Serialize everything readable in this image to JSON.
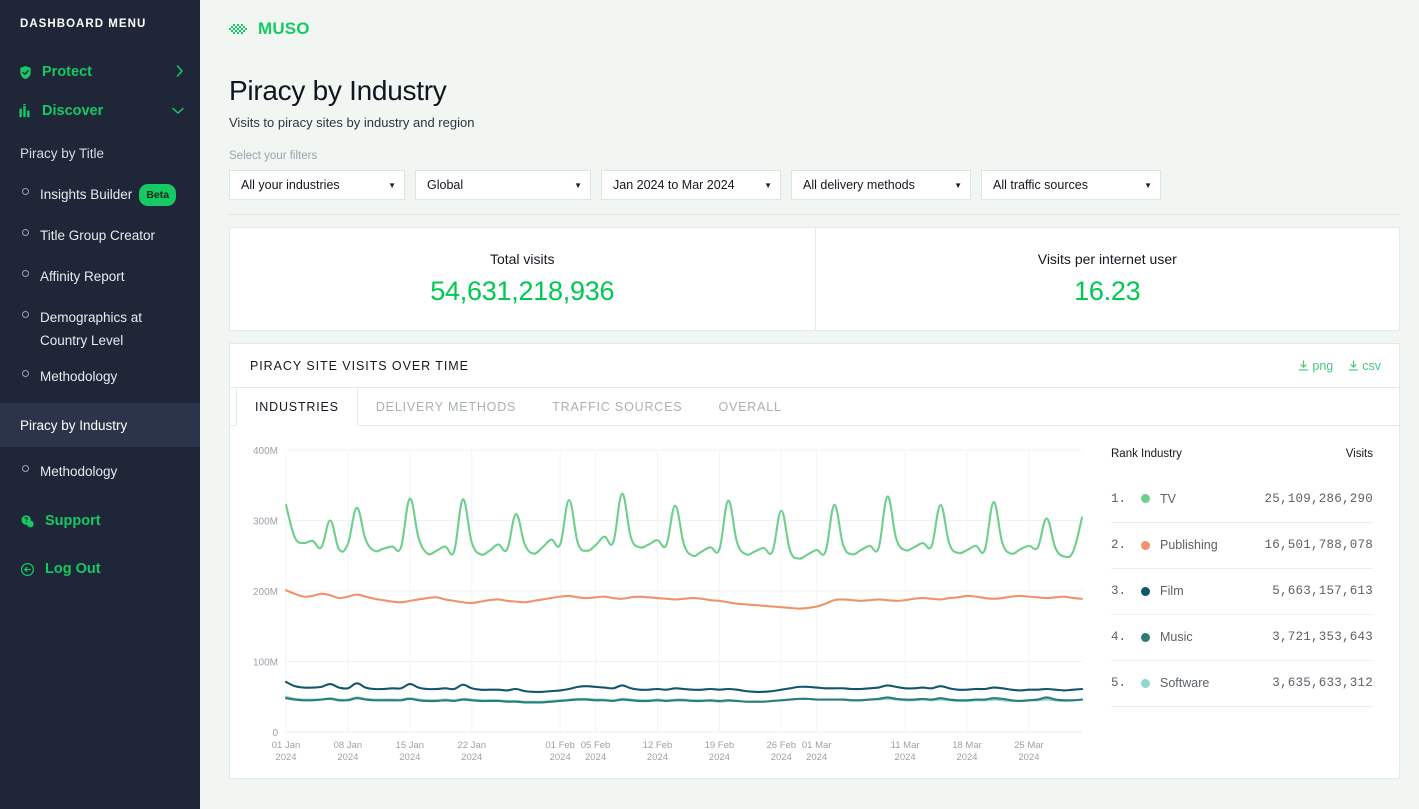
{
  "sidebar": {
    "menu_title": "DASHBOARD MENU",
    "top_items": [
      {
        "label": "Protect",
        "icon": "shield-check-icon",
        "chevron": "chevron-right-icon"
      },
      {
        "label": "Discover",
        "icon": "bar-chart-icon",
        "chevron": "chevron-down-icon"
      }
    ],
    "groups": [
      {
        "label": "Piracy by Title",
        "active": false,
        "items": [
          {
            "label": "Insights Builder",
            "badge": "Beta"
          },
          {
            "label": "Title Group Creator",
            "badge": ""
          },
          {
            "label": "Affinity Report",
            "badge": ""
          },
          {
            "label": "Demographics at Country Level",
            "badge": ""
          },
          {
            "label": "Methodology",
            "badge": ""
          }
        ]
      },
      {
        "label": "Piracy by Industry",
        "active": true,
        "items": [
          {
            "label": "Methodology",
            "badge": ""
          }
        ]
      }
    ],
    "bottom_items": [
      {
        "label": "Support",
        "icon": "chat-help-icon"
      },
      {
        "label": "Log Out",
        "icon": "logout-icon"
      }
    ],
    "accent_color": "#17c964",
    "background_color": "#1f2637",
    "active_item_background": "#2b3449"
  },
  "brand": {
    "logo_text": "MUSO",
    "logo_icon": "muso-diamond-icon",
    "color": "#16c962"
  },
  "page": {
    "title": "Piracy by Industry",
    "subtitle": "Visits to piracy sites by industry and region",
    "filters_label": "Select your filters",
    "filters": [
      {
        "name": "industries-filter",
        "value": "All your industries"
      },
      {
        "name": "region-filter",
        "value": "Global"
      },
      {
        "name": "date-range-filter",
        "value": "Jan 2024 to Mar 2024"
      },
      {
        "name": "delivery-methods-filter",
        "value": "All delivery methods"
      },
      {
        "name": "traffic-sources-filter",
        "value": "All traffic sources"
      }
    ]
  },
  "stats": [
    {
      "label": "Total visits",
      "value": "54,631,218,936"
    },
    {
      "label": "Visits per internet user",
      "value": "16.23"
    }
  ],
  "stat_color": "#00c853",
  "chart_panel": {
    "title": "PIRACY SITE VISITS OVER TIME",
    "downloads": [
      {
        "label": "png",
        "icon": "download-icon"
      },
      {
        "label": "csv",
        "icon": "download-icon"
      }
    ],
    "tabs": [
      {
        "label": "INDUSTRIES",
        "active": true
      },
      {
        "label": "DELIVERY METHODS",
        "active": false
      },
      {
        "label": "TRAFFIC SOURCES",
        "active": false
      },
      {
        "label": "OVERALL",
        "active": false
      }
    ]
  },
  "legend": {
    "headers": {
      "rank": "Rank",
      "industry": "Industry",
      "visits": "Visits"
    },
    "rows": [
      {
        "rank": "1.",
        "industry": "TV",
        "visits": "25,109,286,290",
        "color": "#6ecf8c"
      },
      {
        "rank": "2.",
        "industry": "Publishing",
        "visits": "16,501,788,078",
        "color": "#f0926a"
      },
      {
        "rank": "3.",
        "industry": "Film",
        "visits": "5,663,157,613",
        "color": "#12566b"
      },
      {
        "rank": "4.",
        "industry": "Music",
        "visits": "3,721,353,643",
        "color": "#2c7c78"
      },
      {
        "rank": "5.",
        "industry": "Software",
        "visits": "3,635,633,312",
        "color": "#8fd6cd"
      }
    ]
  },
  "chart_data": {
    "type": "line",
    "title": "PIRACY SITE VISITS OVER TIME",
    "xlabel": "",
    "ylabel": "",
    "ylim": [
      0,
      400000000
    ],
    "ytick_labels": [
      "0",
      "100M",
      "200M",
      "300M",
      "400M"
    ],
    "ytick_values": [
      0,
      100000000,
      200000000,
      300000000,
      400000000
    ],
    "grid": true,
    "legend_position": "right-table",
    "xtick_labels": [
      "01 Jan\n2024",
      "08 Jan\n2024",
      "15 Jan\n2024",
      "22 Jan\n2024",
      "01 Feb\n2024",
      "05 Feb\n2024",
      "12 Feb\n2024",
      "19 Feb\n2024",
      "26 Feb\n2024",
      "01 Mar\n2024",
      "11 Mar\n2024",
      "18 Mar\n2024",
      "25 Mar\n2024"
    ],
    "xtick_days": [
      0,
      7,
      14,
      21,
      31,
      35,
      42,
      49,
      56,
      60,
      70,
      77,
      84
    ],
    "x_start": "2024-01-01",
    "x_end": "2024-03-31",
    "x_points": 91,
    "series": [
      {
        "name": "TV",
        "color": "#6ecf8c",
        "values": [
          322,
          276,
          268,
          271,
          262,
          300,
          259,
          267,
          318,
          273,
          257,
          260,
          263,
          262,
          331,
          275,
          253,
          257,
          263,
          256,
          330,
          269,
          252,
          257,
          266,
          259,
          309,
          266,
          253,
          262,
          273,
          266,
          329,
          268,
          257,
          265,
          277,
          269,
          338,
          276,
          262,
          266,
          272,
          265,
          321,
          266,
          250,
          256,
          262,
          259,
          328,
          269,
          252,
          256,
          261,
          256,
          314,
          257,
          246,
          252,
          258,
          256,
          322,
          265,
          252,
          258,
          264,
          261,
          334,
          274,
          258,
          262,
          268,
          264,
          322,
          267,
          254,
          258,
          264,
          258,
          326,
          268,
          253,
          259,
          264,
          262,
          303,
          261,
          249,
          256,
          304
        ],
        "unit": "millions"
      },
      {
        "name": "Publishing",
        "color": "#f0926a",
        "values": [
          201,
          196,
          192,
          193,
          196,
          194,
          190,
          192,
          195,
          192,
          189,
          187,
          185,
          184,
          186,
          188,
          190,
          191,
          188,
          186,
          184,
          183,
          185,
          187,
          188,
          186,
          185,
          184,
          186,
          188,
          190,
          192,
          193,
          191,
          190,
          191,
          192,
          190,
          189,
          191,
          192,
          191,
          190,
          189,
          188,
          189,
          190,
          189,
          187,
          186,
          184,
          182,
          181,
          180,
          179,
          178,
          177,
          176,
          175,
          176,
          178,
          182,
          187,
          188,
          187,
          186,
          187,
          188,
          187,
          186,
          187,
          189,
          190,
          189,
          188,
          190,
          191,
          193,
          192,
          190,
          189,
          190,
          192,
          193,
          192,
          191,
          190,
          191,
          192,
          190,
          189
        ],
        "unit": "millions"
      },
      {
        "name": "Film",
        "color": "#12566b",
        "values": [
          71,
          65,
          63,
          63,
          64,
          68,
          63,
          62,
          69,
          63,
          61,
          61,
          62,
          62,
          68,
          63,
          61,
          61,
          62,
          61,
          67,
          62,
          60,
          60,
          60,
          59,
          61,
          58,
          57,
          57,
          58,
          59,
          61,
          64,
          65,
          64,
          63,
          62,
          66,
          62,
          60,
          60,
          61,
          60,
          62,
          61,
          60,
          60,
          61,
          60,
          61,
          60,
          58,
          57,
          57,
          58,
          60,
          62,
          64,
          64,
          63,
          62,
          62,
          62,
          61,
          61,
          62,
          63,
          66,
          64,
          62,
          62,
          63,
          62,
          65,
          62,
          60,
          60,
          61,
          61,
          63,
          62,
          60,
          59,
          60,
          60,
          61,
          60,
          59,
          60,
          61
        ],
        "unit": "millions"
      },
      {
        "name": "Music",
        "color": "#2c7c78",
        "values": [
          48,
          46,
          45,
          45,
          46,
          47,
          45,
          45,
          48,
          46,
          45,
          45,
          45,
          45,
          47,
          45,
          44,
          44,
          45,
          44,
          46,
          45,
          44,
          44,
          44,
          43,
          43,
          42,
          42,
          42,
          43,
          44,
          45,
          46,
          46,
          45,
          45,
          44,
          46,
          45,
          44,
          44,
          45,
          44,
          45,
          45,
          44,
          44,
          45,
          44,
          45,
          44,
          43,
          43,
          43,
          44,
          45,
          46,
          47,
          47,
          46,
          46,
          46,
          46,
          45,
          45,
          46,
          47,
          49,
          47,
          46,
          46,
          47,
          46,
          48,
          46,
          45,
          45,
          46,
          46,
          48,
          47,
          45,
          44,
          45,
          46,
          49,
          46,
          45,
          45,
          46
        ],
        "unit": "millions"
      },
      {
        "name": "Software",
        "color": "#8fd6cd",
        "values": [
          50,
          47,
          46,
          46,
          46,
          48,
          46,
          46,
          49,
          47,
          46,
          46,
          46,
          46,
          48,
          46,
          45,
          45,
          46,
          45,
          47,
          46,
          45,
          45,
          45,
          44,
          44,
          43,
          43,
          43,
          44,
          45,
          46,
          47,
          47,
          46,
          46,
          45,
          47,
          46,
          45,
          45,
          46,
          45,
          46,
          46,
          45,
          45,
          44,
          43,
          44,
          44,
          43,
          43,
          43,
          44,
          45,
          46,
          47,
          47,
          46,
          46,
          46,
          46,
          45,
          45,
          46,
          46,
          47,
          46,
          45,
          45,
          46,
          45,
          46,
          45,
          44,
          44,
          45,
          45,
          46,
          45,
          44,
          44,
          45,
          45,
          46,
          45,
          44,
          45,
          46
        ],
        "unit": "millions"
      }
    ]
  }
}
